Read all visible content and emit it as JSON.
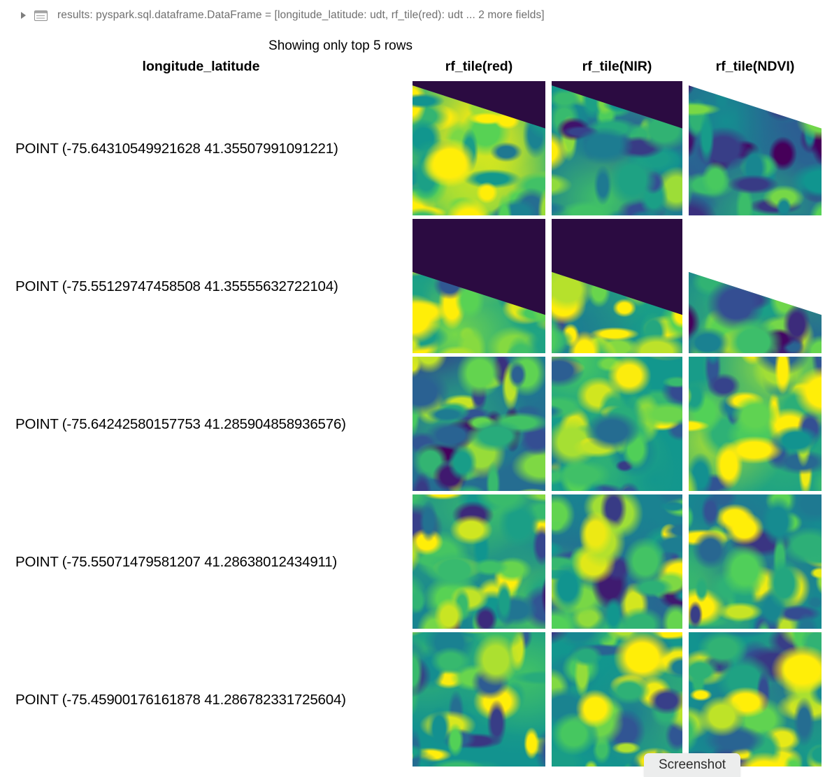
{
  "result_bar": {
    "disclosure_icon": "disclosure-triangle-icon",
    "table_icon": "table-grid-icon",
    "text": "results:  pyspark.sql.dataframe.DataFrame = [longitude_latitude: udt, rf_tile(red): udt ... 2 more fields]"
  },
  "caption": "Showing only top 5 rows",
  "table": {
    "columns": [
      {
        "label": "longitude_latitude",
        "type": "geometry"
      },
      {
        "label": "rf_tile(red)",
        "type": "tile"
      },
      {
        "label": "rf_tile(NIR)",
        "type": "tile"
      },
      {
        "label": "rf_tile(NDVI)",
        "type": "tile"
      }
    ],
    "rows": [
      {
        "point": "POINT (-75.64310549921628 41.35507991091221)",
        "longitude": -75.64310549921628,
        "latitude": 41.35507991091221,
        "tiles": [
          {
            "band": "red",
            "nodata_corner": "top-right",
            "nodata_color": "#2b0b41",
            "nodata_fraction": 0.22,
            "edge_angle_deg": -10
          },
          {
            "band": "NIR",
            "nodata_corner": "top-right",
            "nodata_color": "#2b0b41",
            "nodata_fraction": 0.22,
            "edge_angle_deg": -10
          },
          {
            "band": "NDVI",
            "nodata_corner": "top-right",
            "nodata_color": "#ffffff",
            "nodata_fraction": 0.22,
            "edge_angle_deg": -10
          }
        ]
      },
      {
        "point": "POINT (-75.55129747458508 41.35555632722104)",
        "longitude": -75.55129747458508,
        "latitude": 41.35555632722104,
        "tiles": [
          {
            "band": "red",
            "nodata_corner": "top-right",
            "nodata_color": "#2b0b41",
            "nodata_fraction": 0.55,
            "edge_angle_deg": -14
          },
          {
            "band": "NIR",
            "nodata_corner": "top-right",
            "nodata_color": "#2b0b41",
            "nodata_fraction": 0.55,
            "edge_angle_deg": -14
          },
          {
            "band": "NDVI",
            "nodata_corner": "top-right",
            "nodata_color": "#ffffff",
            "nodata_fraction": 0.55,
            "edge_angle_deg": -14
          }
        ]
      },
      {
        "point": "POINT (-75.64242580157753 41.285904858936576)",
        "longitude": -75.64242580157753,
        "latitude": 41.285904858936576,
        "tiles": [
          {
            "band": "red",
            "nodata_corner": "none",
            "nodata_color": null,
            "nodata_fraction": 0,
            "edge_angle_deg": 0
          },
          {
            "band": "NIR",
            "nodata_corner": "none",
            "nodata_color": null,
            "nodata_fraction": 0,
            "edge_angle_deg": 0
          },
          {
            "band": "NDVI",
            "nodata_corner": "none",
            "nodata_color": null,
            "nodata_fraction": 0,
            "edge_angle_deg": 0
          }
        ]
      },
      {
        "point": "POINT (-75.55071479581207 41.28638012434911)",
        "longitude": -75.55071479581207,
        "latitude": 41.28638012434911,
        "tiles": [
          {
            "band": "red",
            "nodata_corner": "none",
            "nodata_color": null,
            "nodata_fraction": 0,
            "edge_angle_deg": 0
          },
          {
            "band": "NIR",
            "nodata_corner": "none",
            "nodata_color": null,
            "nodata_fraction": 0,
            "edge_angle_deg": 0
          },
          {
            "band": "NDVI",
            "nodata_corner": "none",
            "nodata_color": null,
            "nodata_fraction": 0,
            "edge_angle_deg": 0
          }
        ]
      },
      {
        "point": "POINT (-75.45900176161878 41.286782331725604)",
        "longitude": -75.45900176161878,
        "latitude": 41.286782331725604,
        "tiles": [
          {
            "band": "red",
            "nodata_corner": "none",
            "nodata_color": null,
            "nodata_fraction": 0,
            "edge_angle_deg": 0
          },
          {
            "band": "NIR",
            "nodata_corner": "none",
            "nodata_color": null,
            "nodata_fraction": 0,
            "edge_angle_deg": 0
          },
          {
            "band": "NDVI",
            "nodata_corner": "none",
            "nodata_color": null,
            "nodata_fraction": 0,
            "edge_angle_deg": 0
          }
        ]
      }
    ]
  },
  "overlay": {
    "screenshot_label": "Screenshot"
  },
  "colors": {
    "colormap": "viridis",
    "viridis_stops": [
      "#440154",
      "#3b528b",
      "#21918c",
      "#5ec962",
      "#fde725"
    ],
    "nodata_dark": "#2b0b41",
    "nodata_white": "#ffffff",
    "text": "#000000",
    "result_bar_text": "#6f6f6f",
    "chip_bg": "#eceded"
  }
}
